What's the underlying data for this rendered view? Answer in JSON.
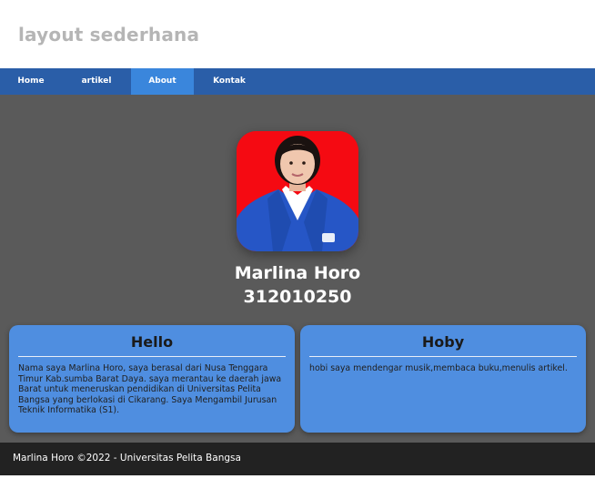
{
  "site": {
    "title": "layout sederhana"
  },
  "nav": {
    "items": [
      {
        "label": "Home"
      },
      {
        "label": "artikel"
      },
      {
        "label": "About"
      },
      {
        "label": "Kontak"
      }
    ],
    "active": "About"
  },
  "profile": {
    "photo_alt": "profile-photo",
    "name": "Marlina Horo",
    "nim": "312010250"
  },
  "cards": {
    "hello": {
      "title": "Hello",
      "body": "Nama saya Marlina Horo, saya berasal dari Nusa Tenggara Timur Kab.sumba Barat Daya. saya merantau ke daerah jawa Barat untuk meneruskan pendidikan di Universitas Pelita Bangsa yang berlokasi di Cikarang. Saya Mengambil Jurusan Teknik Informatika (S1)."
    },
    "hoby": {
      "title": "Hoby",
      "body": "hobi saya mendengar musik,membaca buku,menulis artikel."
    }
  },
  "footer": {
    "text": "Marlina Horo ©2022 - Universitas Pelita Bangsa"
  },
  "colors": {
    "nav_bg": "#2a5ea8",
    "nav_active": "#3a86dc",
    "main_bg": "#5a5a5a",
    "card_bg": "#4f8ee0",
    "footer_bg": "#222222",
    "photo_bg": "#f50a12"
  }
}
